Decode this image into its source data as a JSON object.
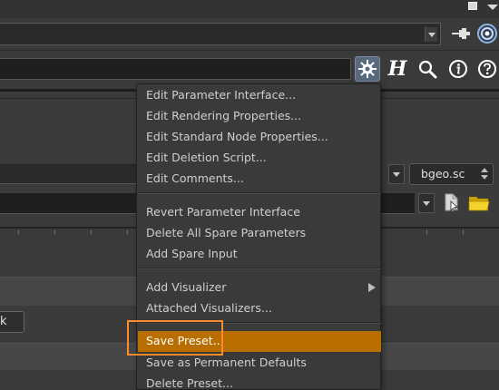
{
  "path_bar": {
    "value": ""
  },
  "toolbar": {
    "name_value": "",
    "help_label": "H"
  },
  "params": {
    "format_value": "bgeo.sc",
    "button_label": "k"
  },
  "context_menu": {
    "items": [
      "Edit Parameter Interface...",
      "Edit Rendering Properties...",
      "Edit Standard Node Properties...",
      "Edit Deletion Script...",
      "Edit Comments...",
      "Revert Parameter Interface",
      "Delete All Spare Parameters",
      "Add Spare Input",
      "Add Visualizer",
      "Attached Visualizers...",
      "Save Preset...",
      "Save as Permanent Defaults",
      "Delete Preset..."
    ],
    "highlighted_item": "Save Preset..."
  },
  "colors": {
    "highlight": "#b86e00",
    "focus_outline": "#ff8a2a",
    "gear_button": "#5a6a7e"
  },
  "icons": [
    "window-maximize-icon",
    "window-menu-icon",
    "pin-icon",
    "target-icon",
    "gear-icon",
    "search-icon",
    "info-icon",
    "question-icon",
    "file-browse-icon",
    "folder-icon",
    "submenu-arrow-icon"
  ]
}
